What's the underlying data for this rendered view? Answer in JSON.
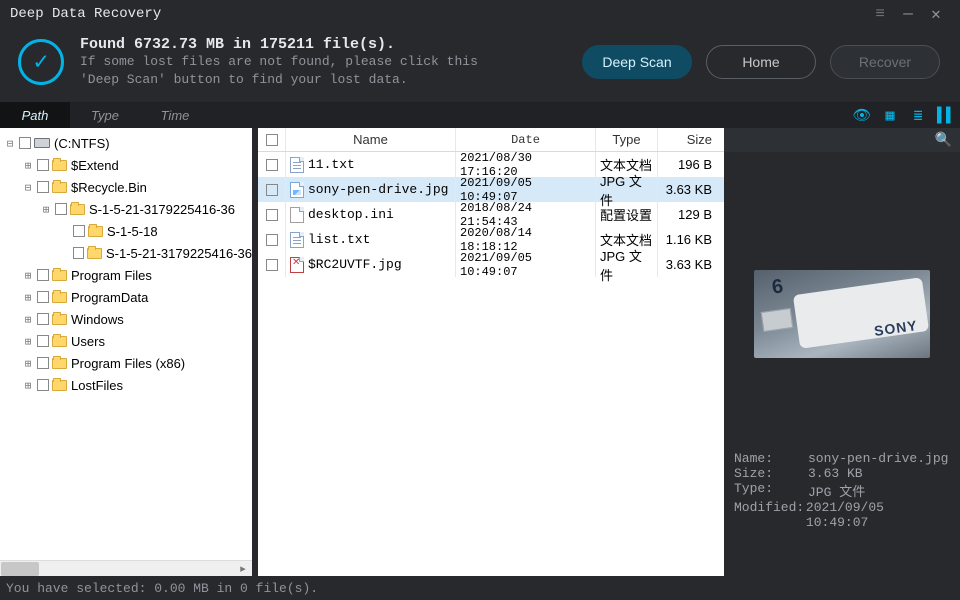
{
  "app_title": "Deep Data Recovery",
  "header": {
    "found_line": "Found 6732.73 MB in 175211 file(s).",
    "hint1": "If some lost files are not found, please click this",
    "hint2": "'Deep Scan' button to find your lost data.",
    "deep_scan": "Deep Scan",
    "home": "Home",
    "recover": "Recover"
  },
  "tabs": {
    "path": "Path",
    "type": "Type",
    "time": "Time"
  },
  "tree": {
    "root": "(C:NTFS)",
    "items": [
      "$Extend",
      "$Recycle.Bin",
      "S-1-5-21-3179225416-36",
      "S-1-5-18",
      "S-1-5-21-3179225416-36",
      "Program Files",
      "ProgramData",
      "Windows",
      "Users",
      "Program Files (x86)",
      "LostFiles"
    ]
  },
  "columns": {
    "name": "Name",
    "date": "Date",
    "type": "Type",
    "size": "Size"
  },
  "files": [
    {
      "name": "11.txt",
      "date": "2021/08/30 17:16:20",
      "type": "文本文档",
      "size": "196  B"
    },
    {
      "name": "sony-pen-drive.jpg",
      "date": "2021/09/05 10:49:07",
      "type": "JPG 文件",
      "size": "3.63 KB"
    },
    {
      "name": "desktop.ini",
      "date": "2018/08/24 21:54:43",
      "type": "配置设置",
      "size": "129  B"
    },
    {
      "name": "list.txt",
      "date": "2020/08/14 18:18:12",
      "type": "文本文档",
      "size": "1.16 KB"
    },
    {
      "name": "$RC2UVTF.jpg",
      "date": "2021/09/05 10:49:07",
      "type": "JPG 文件",
      "size": "3.63 KB"
    }
  ],
  "preview": {
    "sony": "SONY",
    "cap": "6",
    "meta": {
      "name_k": "Name:",
      "name_v": "sony-pen-drive.jpg",
      "size_k": "Size:",
      "size_v": "3.63 KB",
      "type_k": "Type:",
      "type_v": "JPG 文件",
      "mod_k": "Modified:",
      "mod_v": "2021/09/05 10:49:07"
    }
  },
  "status": "You have selected: 0.00 MB in 0 file(s)."
}
